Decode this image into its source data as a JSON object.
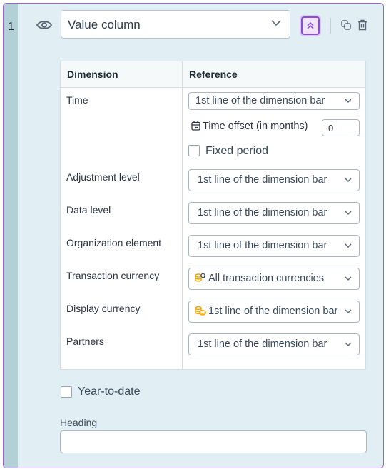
{
  "row_number": "1",
  "column_type": {
    "value": "Value column"
  },
  "table": {
    "headers": {
      "dimension": "Dimension",
      "reference": "Reference"
    },
    "rows": [
      {
        "dimension": "Time",
        "reference": "1st line of the dimension bar"
      },
      {
        "dimension": "Adjustment level",
        "reference": "1st line of the dimension bar"
      },
      {
        "dimension": "Data level",
        "reference": "1st line of the dimension bar"
      },
      {
        "dimension": "Organization element",
        "reference": "1st line of the dimension bar"
      },
      {
        "dimension": "Transaction currency",
        "reference": "All transaction currencies",
        "icon": "currency-search-icon"
      },
      {
        "dimension": "Display currency",
        "reference": "1st line of the dimension bar",
        "icon": "currency-icon"
      },
      {
        "dimension": "Partners",
        "reference": "1st line of the dimension bar"
      }
    ],
    "time_offset": {
      "label": "Time offset (in months)",
      "value": "0"
    },
    "fixed_period": {
      "label": "Fixed period",
      "checked": false
    }
  },
  "year_to_date": {
    "label": "Year-to-date",
    "checked": false
  },
  "heading": {
    "label": "Heading",
    "value": ""
  },
  "colors": {
    "accent": "#8a4ed3",
    "background": "#e1eff4",
    "gutter": "#b3d0d6",
    "coin": "#f0a500"
  }
}
